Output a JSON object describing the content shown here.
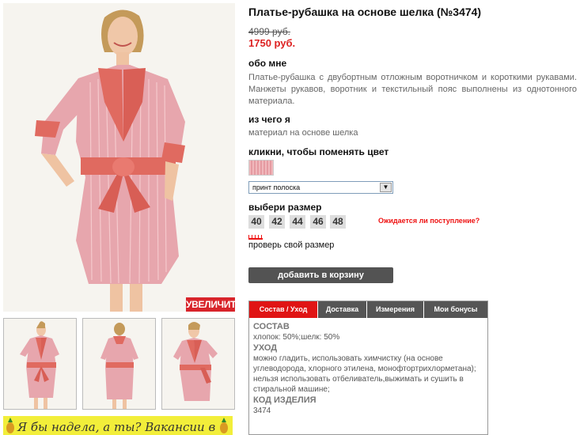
{
  "gallery": {
    "zoom_label": "УВЕЛИЧИТЬ",
    "thumbnail_count": 3,
    "banner_text": "Я бы надела, а ты? Вакансии в"
  },
  "product": {
    "title": "Платье-рубашка на основе шелка (№3474)",
    "old_price": "4999 руб.",
    "new_price": "1750 руб.",
    "about_heading": "обо мне",
    "about_text": "Платье-рубашка с двубортным отложным воротничком и короткими рукавами. Манжеты рукавов, воротник и текстильный пояс выполнены из однотонного материала.",
    "material_heading": "из чего я",
    "material_text": "материал на основе шелка",
    "color_heading": "кликни, чтобы поменять цвет",
    "color_select_value": "принт полоска",
    "size_heading": "выбери размер",
    "sizes": [
      "40",
      "42",
      "44",
      "46",
      "48"
    ],
    "notify_label": "Ожидается ли поступление?",
    "check_size_label": "проверь свой размер",
    "add_to_cart_label": "добавить в корзину"
  },
  "tabs": {
    "items": [
      "Состав / Уход",
      "Доставка",
      "Измерения",
      "Мои бонусы"
    ],
    "active_index": 0,
    "content": {
      "composition_heading": "СОСТАВ",
      "composition_text": "хлопок: 50%;шелк: 50%",
      "care_heading": "УХОД",
      "care_text": "можно гладить, использовать химчистку (на основе углеводорода, хлорного этилена, монофтортрихлорметана); нельзя использовать отбеливатель,выжимать и сушить в стиральной машине;",
      "code_heading": "КОД ИЗДЕЛИЯ",
      "code_value": "3474"
    }
  },
  "colors": {
    "accent_red": "#e01414",
    "price_red": "#dd2222",
    "cart_button": "#535353",
    "dress_pink": "#e7a6ad",
    "dress_coral": "#e06a60",
    "banner_yellow": "#f2ee3a"
  }
}
